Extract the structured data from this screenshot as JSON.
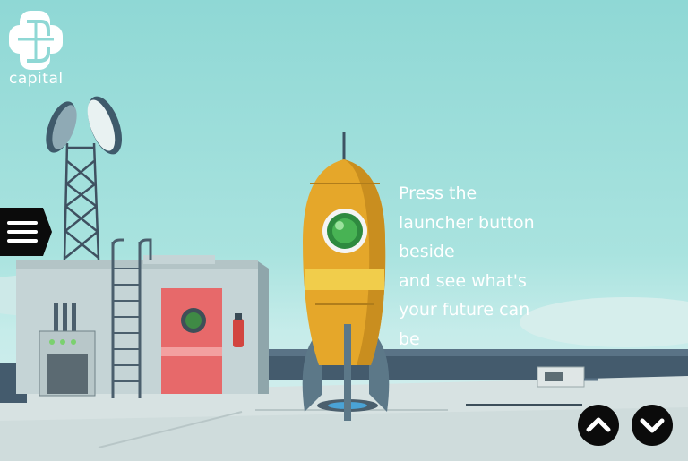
{
  "brand": {
    "name": "capital",
    "logo_icon": "capital-logo-icon"
  },
  "menu": {
    "icon": "hamburger-menu-icon"
  },
  "message": {
    "lines": [
      "Press the",
      "launcher button",
      "beside",
      "and see what's",
      "your future can",
      "be"
    ]
  },
  "navigation": {
    "up_icon": "chevron-up-icon",
    "down_icon": "chevron-down-icon"
  },
  "colors": {
    "sky": "#9adcd8",
    "rocket": "#e6a92a",
    "door": "#e7696a",
    "button": "#0b0b0b"
  }
}
